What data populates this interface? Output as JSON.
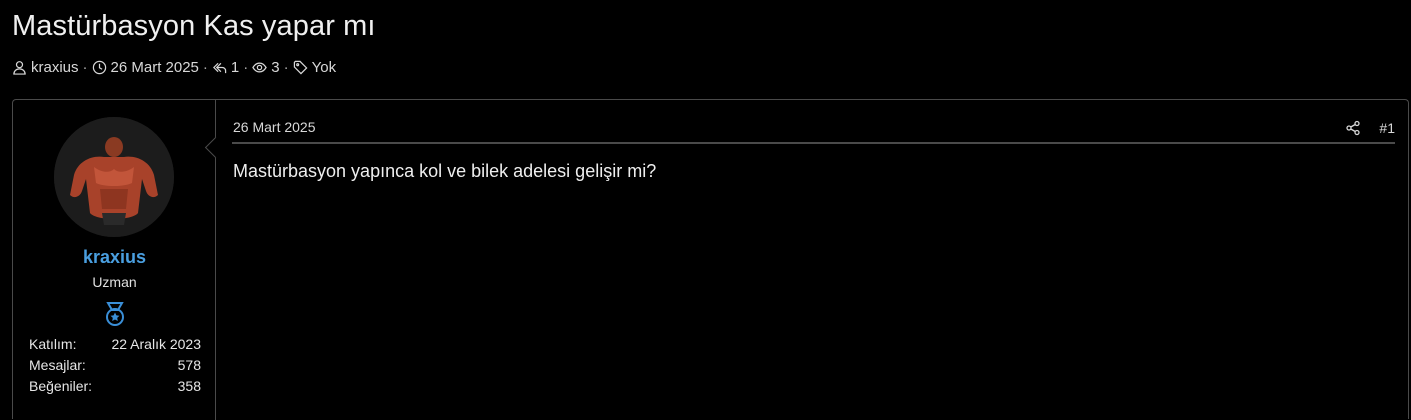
{
  "thread": {
    "title": "Mastürbasyon Kas yapar mı",
    "author": "kraxius",
    "date": "26 Mart 2025",
    "replies": "1",
    "views": "3",
    "tags": "Yok"
  },
  "post": {
    "date": "26 Mart 2025",
    "number": "#1",
    "body": "Mastürbasyon yapınca kol ve bilek adelesi gelişir mi?"
  },
  "user": {
    "name": "kraxius",
    "title": "Uzman",
    "stats": [
      {
        "label": "Katılım:",
        "value": "22 Aralık 2023"
      },
      {
        "label": "Mesajlar:",
        "value": "578"
      },
      {
        "label": "Beğeniler:",
        "value": "358"
      }
    ]
  },
  "colors": {
    "background": "#000000",
    "username": "#4a9fe0",
    "border": "#4a4a4a",
    "medal": "#3a8fd8"
  },
  "icons": {
    "author": "user-icon",
    "date": "clock-icon",
    "replies": "reply-icon",
    "views": "eye-icon",
    "tags": "tag-icon",
    "share": "share-icon",
    "medal": "medal-icon"
  }
}
